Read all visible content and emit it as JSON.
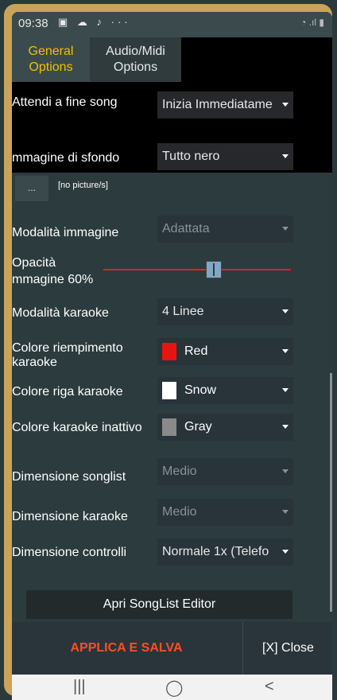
{
  "status": {
    "time": "09:38",
    "icons": "▣ ☁ ♪ ···",
    "right_icons": "◔ .ıl ▮"
  },
  "tabs": [
    {
      "label_line1": "General",
      "label_line2": "Options"
    },
    {
      "label_line1": "Audio/Midi",
      "label_line2": "Options"
    }
  ],
  "settings": {
    "wait_end_label": "Attendi a fine song",
    "wait_end_value": "Inizia Immediatame",
    "bg_image_label": "mmagine di sfondo",
    "bg_image_value": "Tutto nero",
    "browse_label": "...",
    "no_picture": "[no picture/s]",
    "image_mode_label": "Modalità immagine",
    "image_mode_value": "Adattata",
    "opacity_label_line1": "Opacità",
    "opacity_label_line2": "mmagine 60%",
    "opacity_value": 0.6,
    "karaoke_mode_label": "Modalità karaoke",
    "karaoke_mode_value": "4 Linee",
    "fill_color_label_line1": "Colore riempimento",
    "fill_color_label_line2": "karaoke",
    "fill_color_value": "Red",
    "fill_color_hex": "#e8140f",
    "row_color_label": "Colore riga karaoke",
    "row_color_value": "Snow",
    "row_color_hex": "#ffffff",
    "inactive_color_label": "Colore karaoke inattivo",
    "inactive_color_value": "Gray",
    "inactive_color_hex": "#8a8a8a",
    "songlist_size_label": "Dimensione songlist",
    "songlist_size_value": "Medio",
    "karaoke_size_label": "Dimensione karaoke",
    "karaoke_size_value": "Medio",
    "controls_size_label": "Dimensione controlli",
    "controls_size_value": "Normale 1x (Telefo"
  },
  "editor_button": "Apri SongList Editor",
  "footer": {
    "apply": "APPLICA E SALVA",
    "close": "[X] Close"
  },
  "navbar": {
    "recent": "|||",
    "home": "◯",
    "back": "<"
  }
}
